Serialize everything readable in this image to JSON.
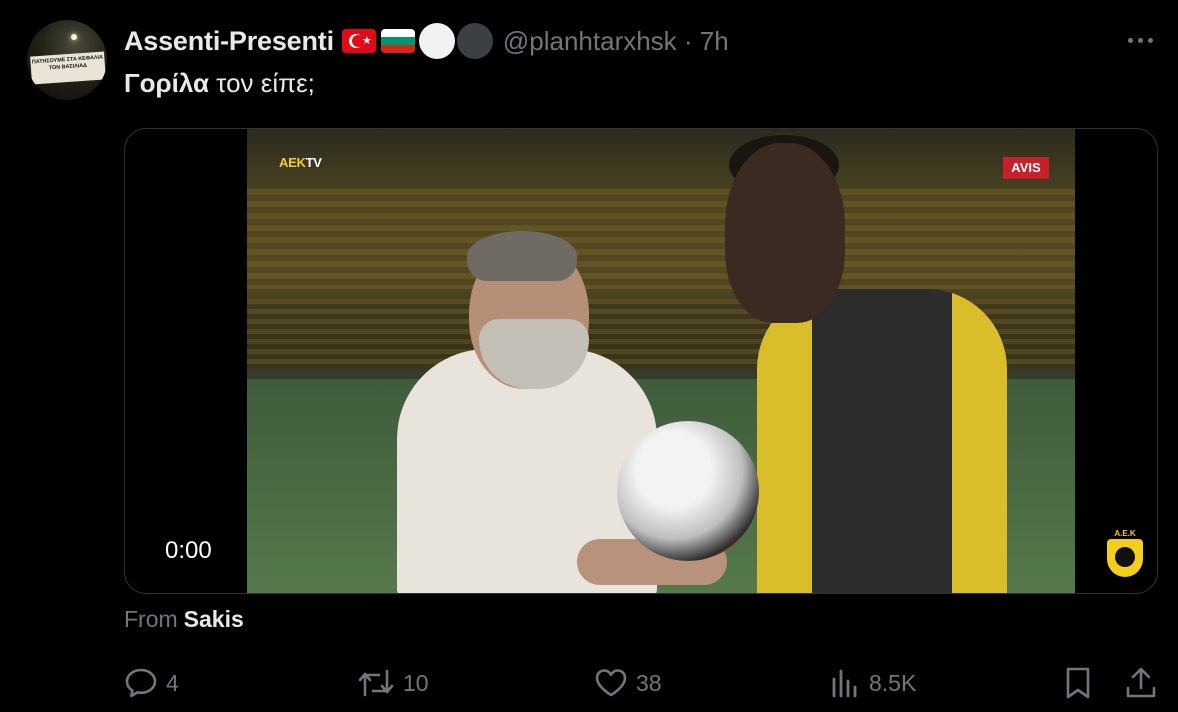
{
  "user": {
    "display_name": "Assenti-Presenti",
    "handle": "@planhtarxhsk",
    "time_separator": " · ",
    "time_ago": "7h",
    "avatar_banner": "ΠΑΤΗΣΟΥΜΕ ΣΤΑ ΚΕΦΑΛΙΑ ΤΟΝ ΒΑΣΙΛΙΑΔ"
  },
  "badges": [
    "flag-turkey-icon",
    "flag-bulgaria-icon",
    "white-circle-icon",
    "dark-circle-icon"
  ],
  "tweet": {
    "text_bold": "Γορίλα",
    "text_rest": " τον είπε;"
  },
  "video": {
    "timestamp": "0:00",
    "overlay_logo_text": "AEK",
    "overlay_logo_suffix": "TV",
    "sponsor_label": "AVIS",
    "crest_label": "Α.Ε.Κ"
  },
  "attribution": {
    "prefix": "From",
    "name": "Sakis"
  },
  "actions": {
    "replies": "4",
    "reposts": "10",
    "likes": "38",
    "views": "8.5K"
  },
  "colors": {
    "background": "#000000",
    "text_primary": "#e7e9ea",
    "text_secondary": "#71767b",
    "border": "#2f3336"
  }
}
